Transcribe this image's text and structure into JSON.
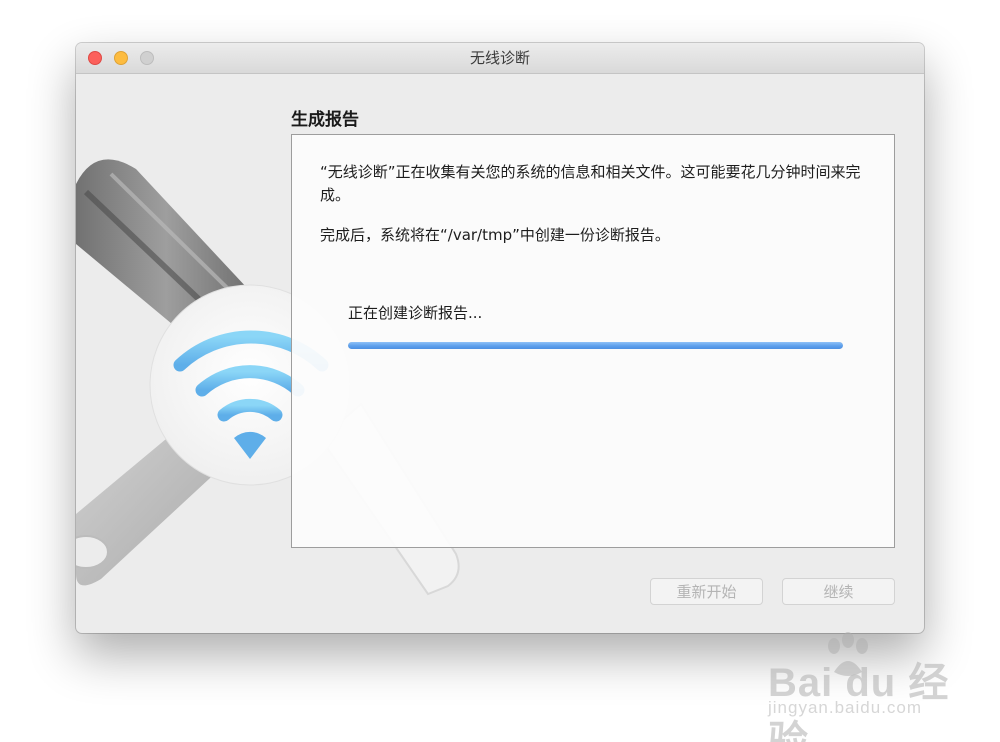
{
  "window": {
    "title": "无线诊断"
  },
  "section": {
    "heading": "生成报告"
  },
  "panel": {
    "paragraph1": "“无线诊断”正在收集有关您的系统的信息和相关文件。这可能要花几分钟时间来完成。",
    "paragraph2": "完成后，系统将在“/var/tmp”中创建一份诊断报告。",
    "status": "正在创建诊断报告...",
    "progress_fraction": 1.0
  },
  "buttons": {
    "restart_label": "重新开始",
    "continue_label": "继续"
  },
  "watermark": {
    "brand": "Bai du 经验",
    "url": "jingyan.baidu.com"
  },
  "colors": {
    "close": "#fc605b",
    "minimize": "#fdbc40",
    "zoom": "#d0d0d0",
    "progress": "#4b8fe2",
    "wifi": "#6cc4f2"
  },
  "icons": [
    "close-icon",
    "minimize-icon",
    "zoom-icon",
    "wrench-icon",
    "screwdriver-icon",
    "wifi-icon",
    "paw-icon"
  ]
}
